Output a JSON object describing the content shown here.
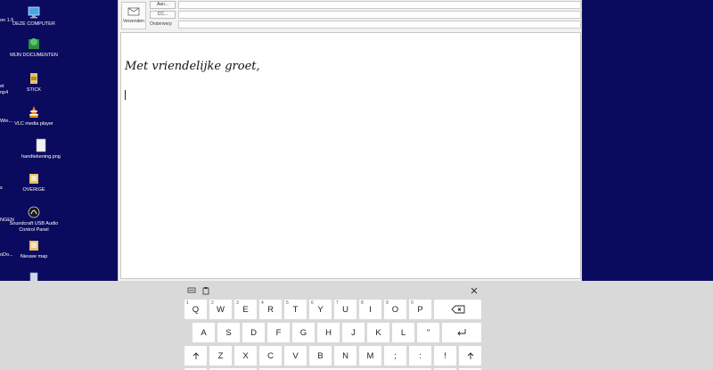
{
  "desktop": {
    "icons": [
      {
        "label": "DEZE COMPUTER",
        "icon": "computer-icon",
        "color": "#4aa3e8"
      },
      {
        "label": "MIJN DOCUMENTEN",
        "icon": "documents-icon",
        "color": "#3aa54a"
      },
      {
        "label": "STICK",
        "icon": "usb-drive-icon",
        "color": "#e7c26a"
      },
      {
        "label": "VLC media player",
        "icon": "vlc-icon",
        "color": "#f08a1c"
      },
      {
        "label": "handtekening.png",
        "icon": "image-file-icon",
        "color": "#f2f2f2"
      },
      {
        "label": "OVERIGE",
        "icon": "folder-icon",
        "color": "#e7c26a"
      },
      {
        "label": "Soundcraft USB Audio Control Panel",
        "icon": "soundcraft-icon",
        "color": "#1a1a1a"
      },
      {
        "label": "Nieuwe map",
        "icon": "folder-icon",
        "color": "#e7c26a"
      },
      {
        "label": "",
        "icon": "recycle-bin-icon",
        "color": "#cfd8e6"
      }
    ],
    "clipped_labels": [
      "on 1.5",
      "et",
      "np4",
      "Win...",
      "s",
      "NGEN",
      "oDo..."
    ]
  },
  "mail": {
    "send_label": "Verzenden",
    "to_label": "Aan...",
    "cc_label": "CC...",
    "subject_label": "Onderwerp",
    "to_value": "",
    "cc_value": "",
    "subject_value": "",
    "signature": "Met vriendelijke groet,"
  },
  "keyboard": {
    "toolbar": {
      "left_icons": [
        "keyboard-settings-icon",
        "clipboard-icon"
      ],
      "close_icon": "close-icon"
    },
    "row1": [
      "Q",
      "W",
      "E",
      "R",
      "T",
      "Y",
      "U",
      "I",
      "O",
      "P"
    ],
    "row1_numbers": [
      "1",
      "2",
      "3",
      "4",
      "5",
      "6",
      "7",
      "8",
      "9",
      "0"
    ],
    "row2": [
      "A",
      "S",
      "D",
      "F",
      "G",
      "H",
      "J",
      "K",
      "L",
      "\""
    ],
    "row3": [
      "Z",
      "X",
      "C",
      "V",
      "B",
      "N",
      "M",
      ";",
      ":",
      "!"
    ]
  }
}
